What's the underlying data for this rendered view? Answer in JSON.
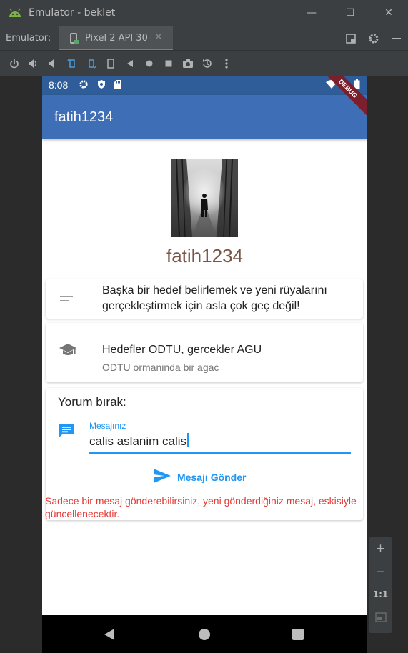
{
  "window": {
    "title": "Emulator - beklet",
    "minimize": "—",
    "maximize": "☐",
    "close": "✕"
  },
  "tabs": {
    "prefix_label": "Emulator:",
    "active_tab": "Pixel 2 API 30",
    "close_glyph": "✕"
  },
  "phone": {
    "status": {
      "time": "8:08"
    },
    "debug_banner": "DEBUG",
    "appbar_title": "fatih1234",
    "profile": {
      "username": "fatih1234"
    },
    "quote_card": {
      "line1": "Başka bir hedef belirlemek ve yeni rüyalarını",
      "line2": "gerçekleştirmek için asla çok geç değil!",
      "icon": "short-text-icon"
    },
    "goal_card": {
      "title": "Hedefler ODTU, gercekler AGU",
      "subtitle": "ODTU ormaninda bir agac",
      "icon": "school-icon"
    },
    "comment": {
      "header": "Yorum bırak:",
      "field_label": "Mesajınız",
      "field_value": "calis aslanim calis",
      "send_label": "Mesajı Gönder",
      "warning": "Sadece bir mesaj gönderebilirsiniz, yeni gönderdiğiniz mesaj, eskisiyle güncellenecektir."
    }
  },
  "zoom_panel": {
    "zoom_in": "+",
    "zoom_out": "−",
    "one_to_one": "1:1"
  },
  "colors": {
    "appbar": "#3e6fb6",
    "statusbar": "#2f5d99",
    "accent": "#2196f3",
    "username": "#795548",
    "warning": "#e53935"
  }
}
